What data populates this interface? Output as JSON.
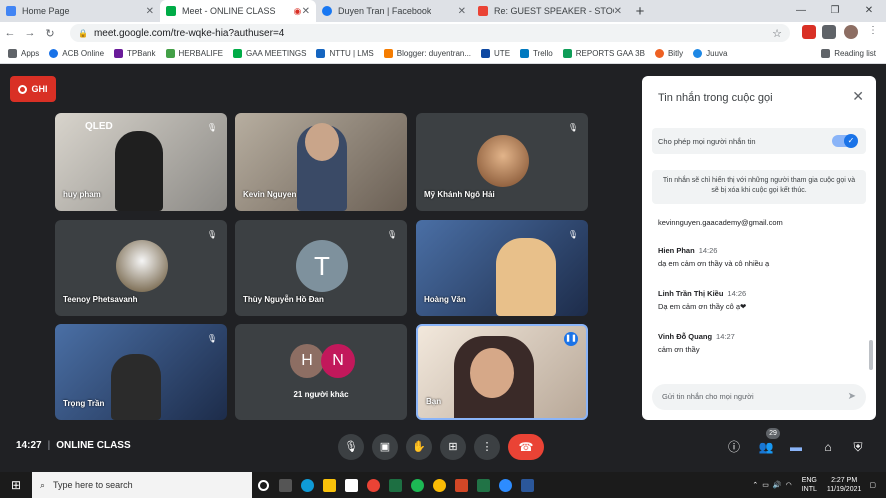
{
  "browser": {
    "tabs": [
      {
        "title": "Home Page",
        "color": "#4285f4",
        "active": false
      },
      {
        "title": "Meet - ONLINE CLASS",
        "color": "#00ac47",
        "active": true
      },
      {
        "title": "Duyen Tran | Facebook",
        "color": "#1877f2",
        "active": false
      },
      {
        "title": "Re: GUEST SPEAKER - STOCK INV",
        "color": "#ea4335",
        "active": false
      }
    ],
    "url": "meet.google.com/tre-wqke-hia?authuser=4",
    "bookmarks": [
      "Apps",
      "ACB Online",
      "TPBank",
      "HERBALIFE",
      "GAA MEETINGS",
      "NTTU | LMS",
      "Blogger: duyentran...",
      "UTE",
      "Trello",
      "REPORTS GAA 3B",
      "Bitly",
      "Juuva",
      "Reading list"
    ]
  },
  "meeting": {
    "record_label": "GHI",
    "participants": [
      {
        "name": "huy pham",
        "muted": true
      },
      {
        "name": "Kevin Nguyen",
        "muted": false
      },
      {
        "name": "Mỹ Khánh Ngô Hải",
        "muted": true
      },
      {
        "name": "Teenoy Phetsavanh",
        "muted": true
      },
      {
        "name": "Thùy Nguyễn Hồ Đan",
        "muted": true,
        "initial": "T"
      },
      {
        "name": "Hoàng Văn",
        "muted": true
      },
      {
        "name": "Trọng Trần",
        "muted": true
      },
      {
        "name": "21 người khác",
        "initials": [
          "H",
          "N"
        ]
      },
      {
        "name": "Bạn",
        "muted": false
      }
    ],
    "time": "14:27",
    "class_name": "ONLINE CLASS",
    "people_count": "29"
  },
  "chat": {
    "title": "Tin nhắn trong cuộc gọi",
    "toggle_label": "Cho phép mọi người nhắn tin",
    "info": "Tin nhắn sẽ chỉ hiển thị với những người tham gia cuộc gọi và sẽ bị xóa khi cuộc gọi kết thúc.",
    "email_msg": "kevinnguyen.gaacademy@gmail.com",
    "messages": [
      {
        "author": "Hien Phan",
        "time": "14:26",
        "text": "dạ em cảm ơn thầy và cô nhiều ạ"
      },
      {
        "author": "Linh Trần Thị Kiều",
        "time": "14:26",
        "text": "Dạ em cảm ơn thầy cô ạ❤"
      },
      {
        "author": "Vinh Đỗ Quang",
        "time": "14:27",
        "text": "cảm ơn thầy"
      }
    ],
    "input_placeholder": "Gửi tin nhắn cho mọi người"
  },
  "taskbar": {
    "search_placeholder": "Type here to search",
    "lang": "ENG",
    "layout": "INTL",
    "time": "2:27 PM",
    "date": "11/19/2021"
  },
  "colors": {
    "accent": "#1a73e8",
    "hangup": "#ea4335",
    "record": "#d93025",
    "avatar_h": "#8d6e63",
    "avatar_n": "#c2185b"
  }
}
